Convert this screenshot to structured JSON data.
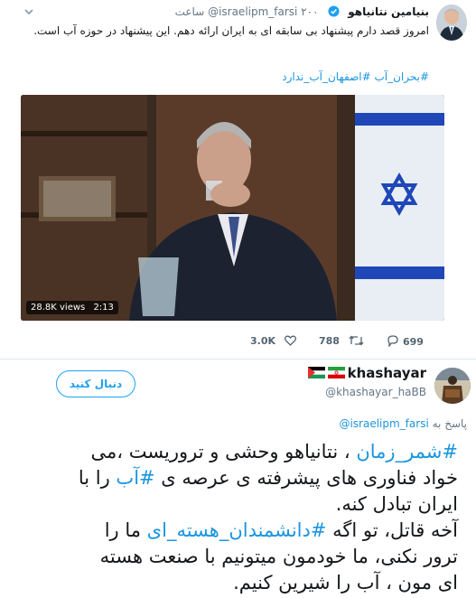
{
  "tweet1": {
    "display_name": "بنیامین نتانیاهو",
    "handle": "@israelipm_farsi",
    "time": "۲۰۰ ساعت",
    "text": "امروز قصد دارم پیشنهاد بی سابقه ای به ایران ارائه دهم. این پیشنهاد در حوزه آب است.",
    "hashtags": "#بحران_آب #اصفهان_آب_ندارد",
    "video_views": "28.8K views",
    "video_duration": "2:13",
    "actions": {
      "replies": "699",
      "retweets": "788",
      "likes": "3.0K"
    },
    "icons": [
      "verified-icon",
      "chevron-down-icon",
      "reply-icon",
      "retweet-icon",
      "heart-icon"
    ]
  },
  "tweet2": {
    "display_name": "khashayar",
    "handle": "@khashayar_haBB",
    "follow_label": "دنبال کنید",
    "reply_prefix": "پاسخ به",
    "reply_to": "@israelipm_farsi",
    "body_lines": [
      {
        "hash": "#شمر_زمان",
        "text": " ، نتانیاهو وحشی و تروریست ،می"
      },
      {
        "text": "خواد فناوری های پیشرفته ی عرصه ی ",
        "hash": "#آب",
        "tail": " را با"
      },
      {
        "text": "ایران تبادل کنه."
      },
      {
        "text": "آخه قاتل، تو اگه ",
        "hash": "#دانشمندان_هسته_ای",
        "tail": " ما را"
      },
      {
        "text": "ترور نکنی، ما خودمون میتونیم با صنعت هسته"
      },
      {
        "text": "ای مون ، آب را شیرین کنیم."
      }
    ],
    "colors": {
      "link": "#1b95e0",
      "follow": "#1da1f2"
    }
  }
}
